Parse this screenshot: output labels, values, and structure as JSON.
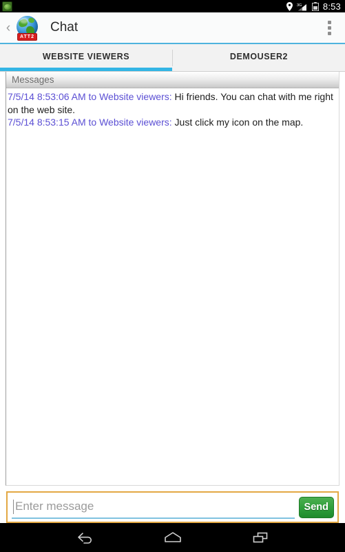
{
  "status_bar": {
    "notification_icon": "app-notification-icon",
    "icons": [
      "location-pin-icon",
      "signal-3g-icon",
      "battery-icon"
    ],
    "time": "8:53"
  },
  "action_bar": {
    "back_icon": "back-caret-icon",
    "logo_icon": "globe-icon",
    "logo_badge": "ATT2",
    "title": "Chat",
    "overflow_icon": "overflow-menu-icon"
  },
  "tabs": [
    {
      "label": "WEBSITE VIEWERS",
      "active": true
    },
    {
      "label": "DEMOUSER2",
      "active": false
    }
  ],
  "messages_panel": {
    "header": "Messages",
    "messages": [
      {
        "meta": "7/5/14 8:53:06 AM to Website viewers:",
        "body": " Hi friends. You can chat with me right on the web site."
      },
      {
        "meta": "7/5/14 8:53:15 AM to Website viewers:",
        "body": " Just click my icon on the map."
      }
    ]
  },
  "input_bar": {
    "placeholder": "Enter message",
    "value": "",
    "send_label": "Send"
  },
  "nav_bar": {
    "back": "back-nav-icon",
    "home": "home-nav-icon",
    "recents": "recents-nav-icon"
  },
  "colors": {
    "accent_blue": "#33b5e5",
    "meta_purple": "#5b4fd4",
    "send_green": "#2e9e3a",
    "input_border_orange": "#e3a843",
    "badge_red": "#d81f1f"
  }
}
